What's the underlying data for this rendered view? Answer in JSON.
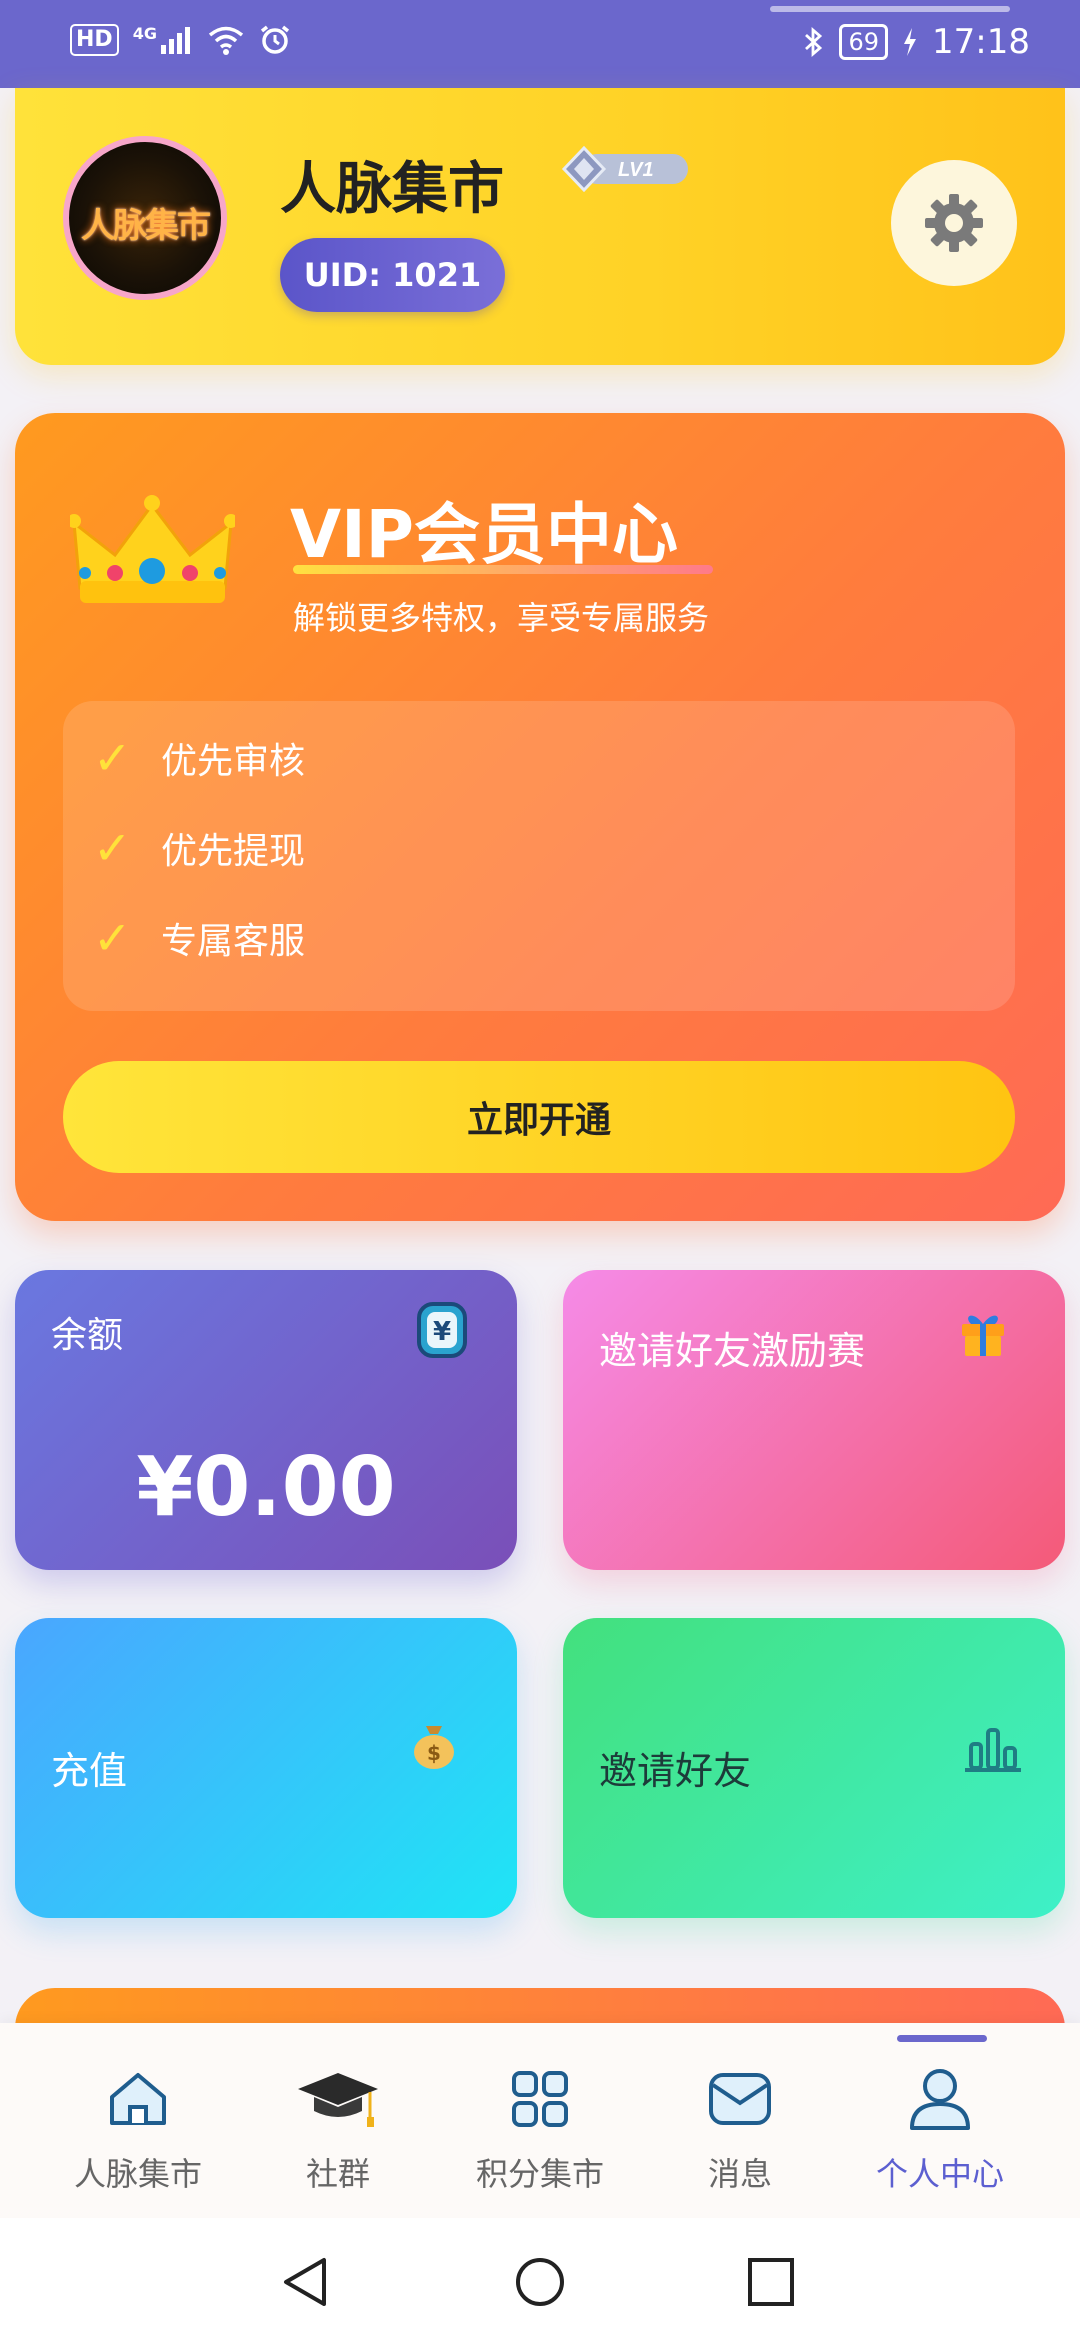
{
  "status_bar": {
    "left_indicators": "HD",
    "network": "4G",
    "battery": "69",
    "time": "17:18"
  },
  "profile": {
    "avatar_text": "人脉集市",
    "name": "人脉集市",
    "level": "LV1",
    "uid": "UID: 1021"
  },
  "vip": {
    "title": "VIP会员中心",
    "subtitle": "解锁更多特权，享受专属服务",
    "benefits": [
      "优先审核",
      "优先提现",
      "专属客服"
    ],
    "open_button": "立即开通"
  },
  "tiles": {
    "balance_label": "余额",
    "balance_value": "¥0.00",
    "invite_race_label": "邀请好友激励赛",
    "recharge_label": "充值",
    "invite_label": "邀请好友"
  },
  "bottom_nav": {
    "items": [
      {
        "label": "人脉集市",
        "icon": "home-icon"
      },
      {
        "label": "社群",
        "icon": "graduation-cap-icon"
      },
      {
        "label": "积分集市",
        "icon": "grid-icon"
      },
      {
        "label": "消息",
        "icon": "mail-icon"
      },
      {
        "label": "个人中心",
        "icon": "user-icon"
      }
    ],
    "active_index": 4
  },
  "colors": {
    "brand_purple": "#6b67cc",
    "gold": "#ffd226",
    "vip_orange": "#ff7c3d"
  }
}
